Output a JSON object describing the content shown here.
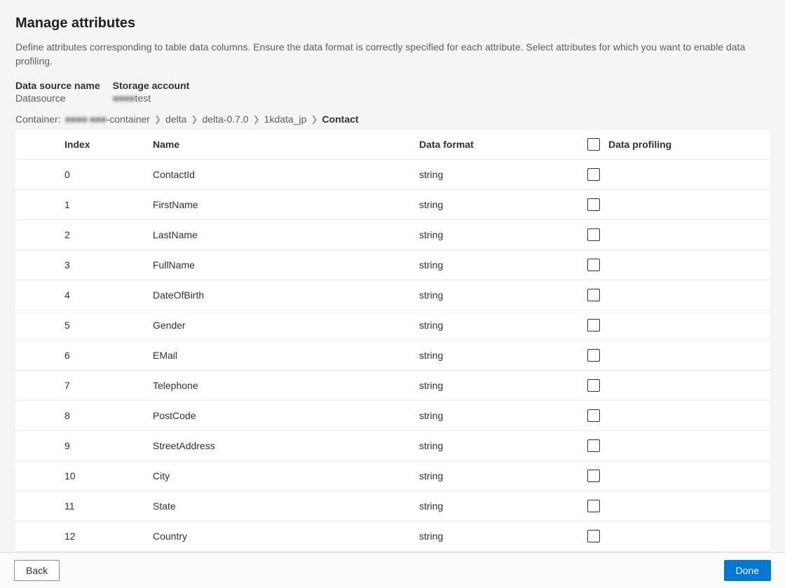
{
  "header": {
    "title": "Manage attributes",
    "description": "Define attributes corresponding to table data columns. Ensure the data format is correctly specified for each attribute. Select attributes for which you want to enable data profiling."
  },
  "meta": {
    "dataSource": {
      "label": "Data source name",
      "value": "Datasource"
    },
    "storageAccount": {
      "label": "Storage account",
      "redacted": "■■■■",
      "suffix": "test"
    }
  },
  "breadcrumb": {
    "prefix": "Container:",
    "redacted": "■■■■ ■■■",
    "items": [
      "-container",
      "delta",
      "delta-0.7.0",
      "1kdata_jp",
      "Contact"
    ]
  },
  "table": {
    "columns": {
      "index": "Index",
      "name": "Name",
      "format": "Data format",
      "profiling": "Data profiling"
    },
    "rows": [
      {
        "index": "0",
        "name": "ContactId",
        "format": "string"
      },
      {
        "index": "1",
        "name": "FirstName",
        "format": "string"
      },
      {
        "index": "2",
        "name": "LastName",
        "format": "string"
      },
      {
        "index": "3",
        "name": "FullName",
        "format": "string"
      },
      {
        "index": "4",
        "name": "DateOfBirth",
        "format": "string"
      },
      {
        "index": "5",
        "name": "Gender",
        "format": "string"
      },
      {
        "index": "6",
        "name": "EMail",
        "format": "string"
      },
      {
        "index": "7",
        "name": "Telephone",
        "format": "string"
      },
      {
        "index": "8",
        "name": "PostCode",
        "format": "string"
      },
      {
        "index": "9",
        "name": "StreetAddress",
        "format": "string"
      },
      {
        "index": "10",
        "name": "City",
        "format": "string"
      },
      {
        "index": "11",
        "name": "State",
        "format": "string"
      },
      {
        "index": "12",
        "name": "Country",
        "format": "string"
      }
    ]
  },
  "footer": {
    "back": "Back",
    "done": "Done"
  }
}
